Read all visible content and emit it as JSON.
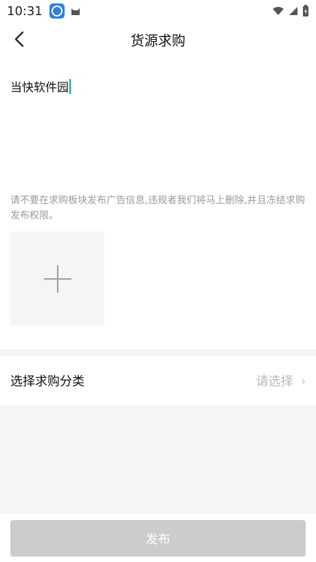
{
  "status_bar": {
    "time": "10:31"
  },
  "header": {
    "title": "货源求购",
    "back_icon": "chevron-left-icon"
  },
  "form": {
    "content_value": "当快软件园",
    "hint": "请不要在求购板块发布广告信息,违规者我们将马上删除,并且冻结求购发布权限。",
    "add_image_icon": "plus-icon",
    "category_label": "选择求购分类",
    "category_placeholder": "请选择"
  },
  "footer": {
    "publish_label": "发布"
  },
  "colors": {
    "caret": "#16a085",
    "publish_disabled": "#cccccc",
    "placeholder": "#b8b8b8",
    "hint_text": "#9a9a9a",
    "section_bg": "#f5f5f5"
  }
}
